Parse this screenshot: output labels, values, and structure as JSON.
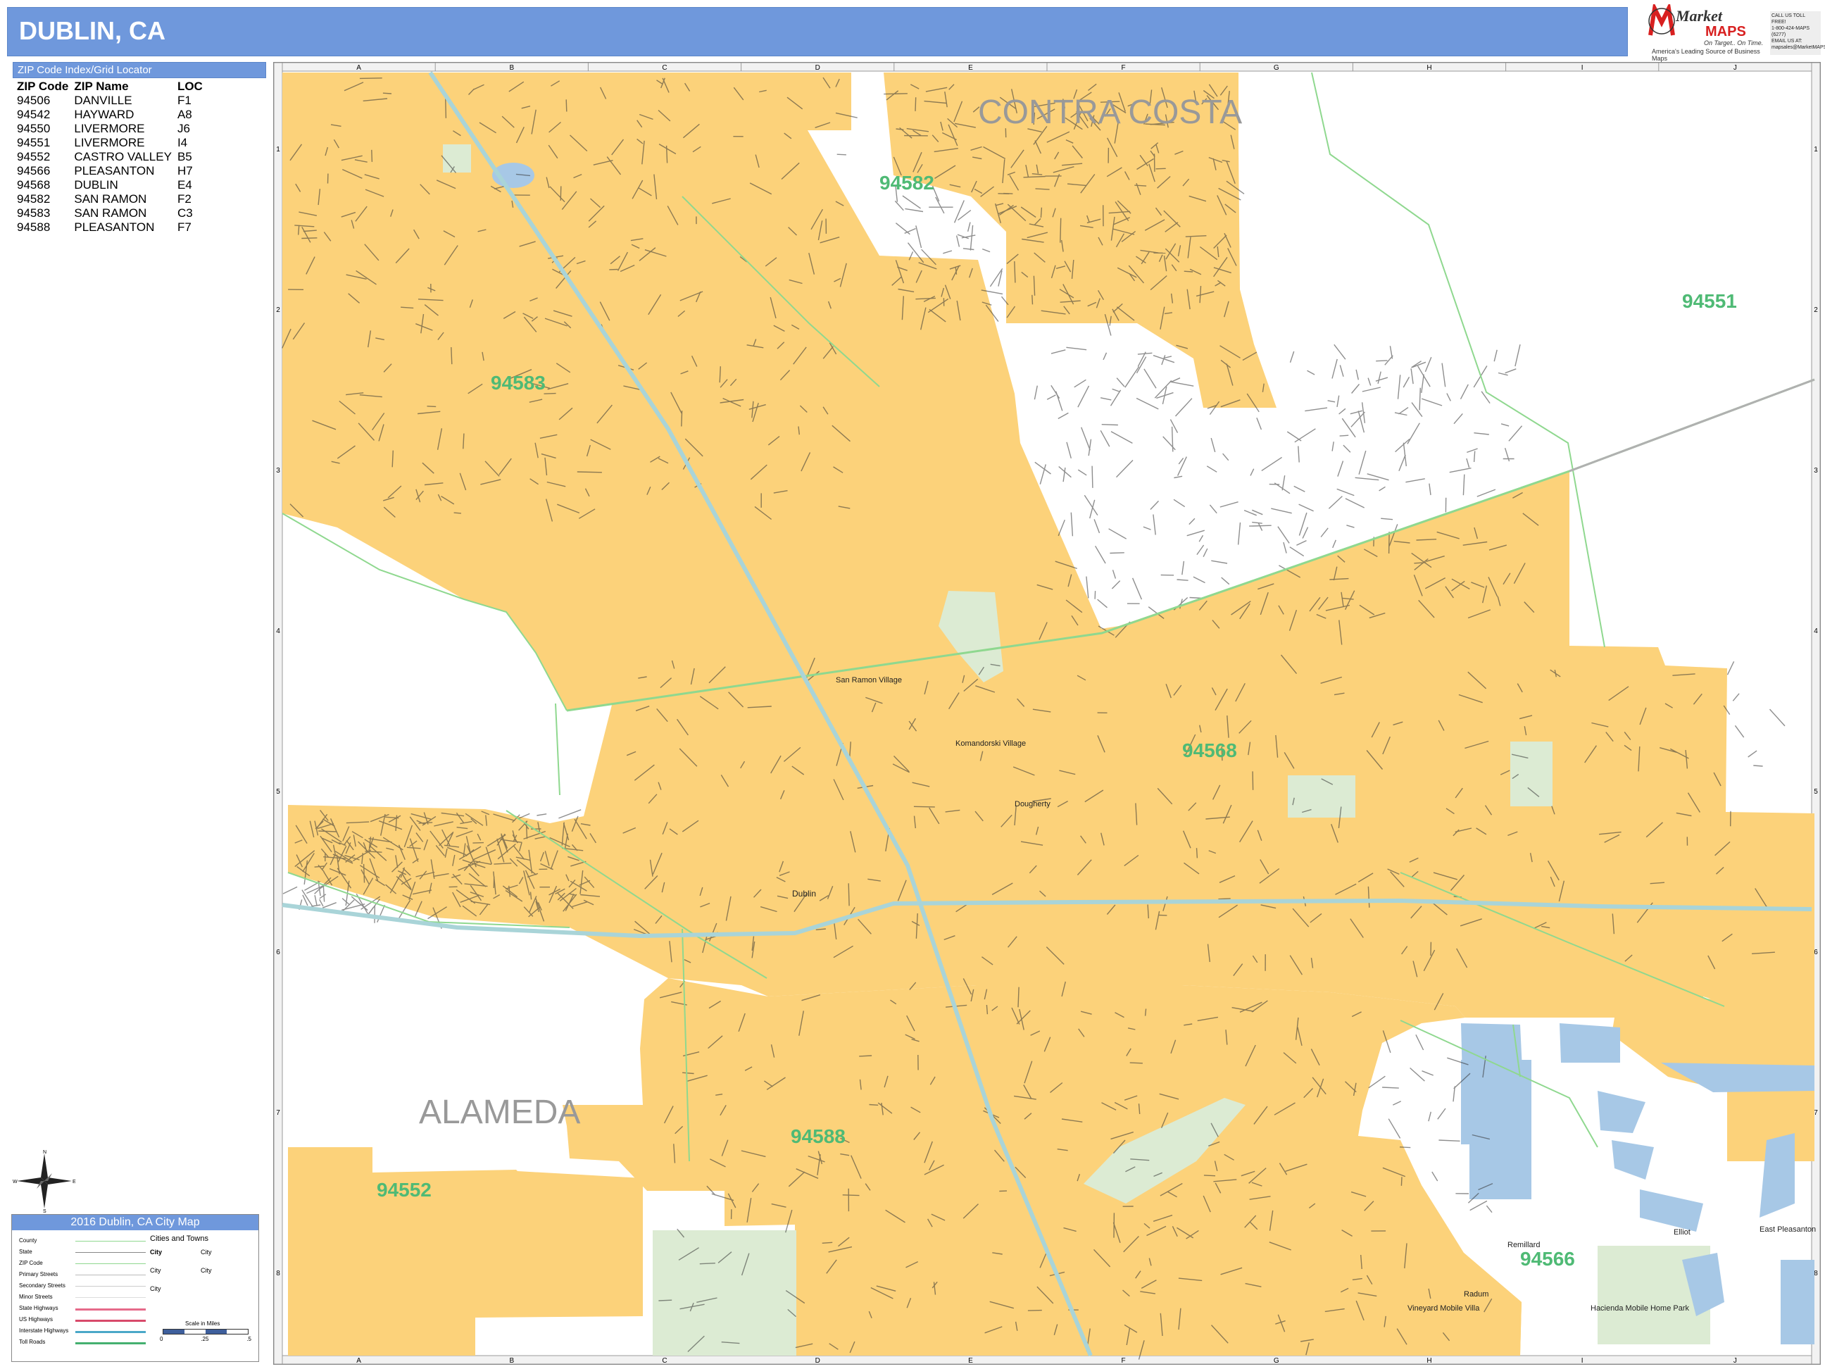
{
  "title": "DUBLIN, CA",
  "logo": {
    "brand_word1": "Market",
    "brand_word2": "MAPS",
    "tagline": "On Target.. On Time.",
    "subline": "America's Leading Source of Business Maps",
    "contact_lines": [
      "CALL US TOLL FREE!",
      "1-800-424-MAPS (6277)",
      "EMAIL US AT:",
      "mapsales@MarketMAPS.com"
    ]
  },
  "zip_index": {
    "heading": "ZIP Code Index/Grid Locator",
    "columns": [
      "ZIP Code",
      "ZIP Name",
      "LOC"
    ],
    "rows": [
      [
        "94506",
        "DANVILLE",
        "F1"
      ],
      [
        "94542",
        "HAYWARD",
        "A8"
      ],
      [
        "94550",
        "LIVERMORE",
        "J6"
      ],
      [
        "94551",
        "LIVERMORE",
        "I4"
      ],
      [
        "94552",
        "CASTRO VALLEY",
        "B5"
      ],
      [
        "94566",
        "PLEASANTON",
        "H7"
      ],
      [
        "94568",
        "DUBLIN",
        "E4"
      ],
      [
        "94582",
        "SAN RAMON",
        "F2"
      ],
      [
        "94583",
        "SAN RAMON",
        "C3"
      ],
      [
        "94588",
        "PLEASANTON",
        "F7"
      ]
    ]
  },
  "grid": {
    "columns": [
      "A",
      "B",
      "C",
      "D",
      "E",
      "F",
      "G",
      "H",
      "I",
      "J"
    ],
    "rows": [
      "1",
      "2",
      "3",
      "4",
      "5",
      "6",
      "7",
      "8"
    ]
  },
  "map_labels": {
    "counties": [
      "CONTRA COSTA",
      "ALAMEDA"
    ],
    "zip_labels": [
      "94582",
      "94551",
      "94583",
      "94568",
      "94588",
      "94552",
      "94566"
    ],
    "places": [
      "San Ramon Village",
      "Komandorski Village",
      "Dougherty",
      "Dublin",
      "Radum",
      "Remillard",
      "Elliot",
      "East Pleasanton",
      "Vineyard Mobile Villa",
      "Hacienda Mobile Home Park"
    ]
  },
  "compass": {
    "n": "N",
    "s": "S",
    "e": "E",
    "w": "W"
  },
  "legend": {
    "title": "2016 Dublin, CA City Map",
    "cities_heading": "Cities and Towns",
    "items": [
      "County",
      "State",
      "ZIP Code",
      "Primary Streets",
      "Secondary Streets",
      "Minor Streets",
      "State Highways",
      "US Highways",
      "Interstate Highways",
      "Toll Roads"
    ],
    "city_marks": [
      "City",
      "City",
      "City",
      "City",
      "City"
    ],
    "scale_label": "Scale in Miles",
    "scale_ticks": [
      "0",
      ".25",
      ".5"
    ]
  },
  "colors": {
    "zip_fill": "#fcd27a",
    "water": "#a7c8e6",
    "park": "#dcebd3",
    "zip_boundary": "#8fd88f",
    "highway": "#a9d4d8",
    "title_bar": "#6f98dc",
    "zip_label": "#4fba75",
    "county_label": "#999999"
  }
}
